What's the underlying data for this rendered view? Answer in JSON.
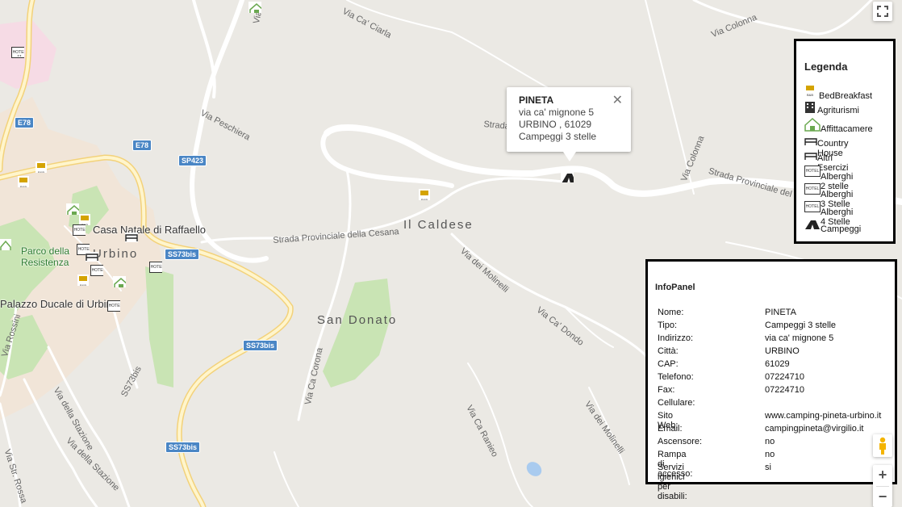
{
  "map": {
    "road_labels": [
      "Via Ca' Ciarla",
      "Via Colonna",
      "Via Peschiera",
      "Strada",
      "Strada Provinciale del",
      "Via Colonna",
      "Strada Provinciale della Cesana",
      "Via dei Molinelli",
      "Via Ca' Dondo",
      "Via Ca Corona",
      "Via Ca Ranieo",
      "Via dei Molinelli",
      "Via della Stazione",
      "Via della Stazione",
      "Via Str. Rossa",
      "Via Rossini",
      "SS73bis",
      "Via"
    ],
    "shields": [
      "E78",
      "E78",
      "SP423",
      "SS73bis",
      "SS73bis",
      "SS73bis"
    ],
    "places": [
      "Il Caldese",
      "San Donato",
      "Urbino"
    ],
    "pois": [
      "Casa Natale di Raffaello",
      "Parco della",
      "Resistenza",
      "Palazzo Ducale di Urbino"
    ],
    "marker_icons": [
      "hotel-icon",
      "bed-breakfast-icon",
      "affittacamere-icon",
      "country-house-icon",
      "campeggi-icon"
    ]
  },
  "infowindow": {
    "title": "PINETA",
    "line1": "via ca' mignone 5",
    "line2": "URBINO , 61029",
    "line3": "Campeggi 3 stelle",
    "close": "✕"
  },
  "legend": {
    "title": "Legenda",
    "items": [
      {
        "label": "BedBreakfast",
        "icon": "bed-breakfast-icon"
      },
      {
        "label": "Agriturismi",
        "icon": "agriturismi-icon"
      },
      {
        "label": "Affittacamere",
        "icon": "affittacamere-icon"
      },
      {
        "label": "Country House",
        "icon": "country-house-icon"
      },
      {
        "label": "Altri Esercizi",
        "icon": "altri-esercizi-icon"
      },
      {
        "label": "Alberghi 2 stelle",
        "icon": "hotel-2-icon"
      },
      {
        "label": "Alberghi 3 Stelle",
        "icon": "hotel-3-icon"
      },
      {
        "label": "Alberghi 4 Stelle",
        "icon": "hotel-4-icon"
      },
      {
        "label": "Campeggi",
        "icon": "campeggi-icon"
      }
    ]
  },
  "infopanel": {
    "title": "InfoPanel",
    "rows": [
      {
        "k": "Nome:",
        "v": "PINETA"
      },
      {
        "k": "Tipo:",
        "v": "Campeggi 3 stelle"
      },
      {
        "k": "Indirizzo:",
        "v": "via ca' mignone 5"
      },
      {
        "k": "Città:",
        "v": "URBINO"
      },
      {
        "k": "CAP:",
        "v": "61029"
      },
      {
        "k": "Telefono:",
        "v": "07224710"
      },
      {
        "k": "Fax:",
        "v": "07224710"
      },
      {
        "k": "Cellulare:",
        "v": ""
      },
      {
        "k": "Sito Web:",
        "v": "www.camping-pineta-urbino.it"
      },
      {
        "k": "Email:",
        "v": "campingpineta@virgilio.it"
      },
      {
        "k": "Ascensore:",
        "v": "no"
      },
      {
        "k": "Rampa di accesso:",
        "v": "no"
      },
      {
        "k": "Servizi igienici per disabili:",
        "v": "si"
      }
    ]
  },
  "controls": {
    "zoom_in": "+",
    "zoom_out": "−"
  }
}
